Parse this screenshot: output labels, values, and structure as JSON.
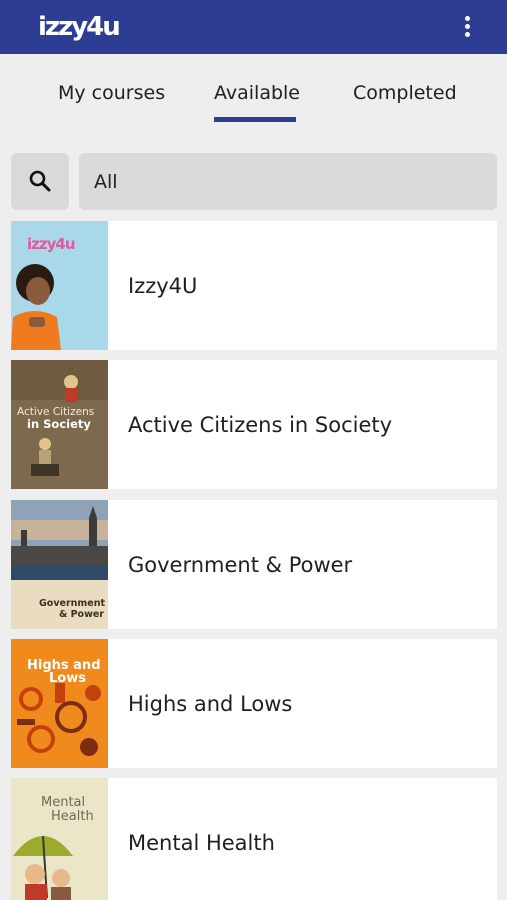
{
  "app": {
    "logo_text": "izzy4u"
  },
  "header": {
    "menu_icon": "more-vert-icon",
    "brand_color": "#2e3d94"
  },
  "tabs": [
    {
      "label": "My courses",
      "selected": false
    },
    {
      "label": "Available",
      "selected": true
    },
    {
      "label": "Completed",
      "selected": false
    }
  ],
  "search": {
    "icon": "search-icon",
    "filter_value": "All"
  },
  "courses": [
    {
      "title": "Izzy4U",
      "thumb_text": "izzy4u"
    },
    {
      "title": "Active Citizens in Society",
      "thumb_text": [
        "Active Citizens",
        "in Society"
      ]
    },
    {
      "title": "Government & Power",
      "thumb_text": [
        "Government",
        "& Power"
      ]
    },
    {
      "title": "Highs and Lows",
      "thumb_text": [
        "Highs and",
        "Lows"
      ]
    },
    {
      "title": "Mental Health",
      "thumb_text": [
        "Mental",
        "Health"
      ]
    }
  ]
}
